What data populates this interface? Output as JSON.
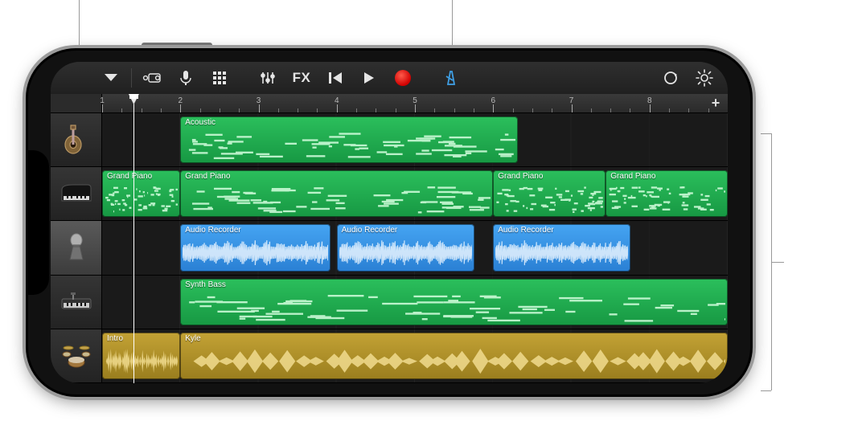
{
  "colors": {
    "accent_blue": "#3fa0e6",
    "record_red": "#d00000",
    "midi_green": "#2bbf5c",
    "audio_blue": "#45a4f2",
    "drum_yellow": "#c3a235"
  },
  "toolbar": {
    "view_menu": "▾",
    "instruments": "camera-icon",
    "microphone": "mic-icon",
    "grid": "grid-icon",
    "mixer": "sliders-icon",
    "fx_label": "FX",
    "rewind": "skip-back-icon",
    "play": "play-icon",
    "record": "record-icon",
    "metronome": "metronome-icon",
    "loop": "loop-icon",
    "settings": "gear-icon"
  },
  "ruler": {
    "bars": [
      1,
      2,
      3,
      4,
      5,
      6,
      7,
      8
    ],
    "beats_per_bar": 4,
    "add_section_label": "+"
  },
  "playhead": {
    "position_pct": 5.0
  },
  "tracks": [
    {
      "id": "acoustic",
      "icon": "guitar-icon",
      "selected": false,
      "regions": [
        {
          "label": "Acoustic",
          "type": "midi",
          "color": "green",
          "start_pct": 12.5,
          "width_pct": 54.0
        }
      ]
    },
    {
      "id": "grand-piano",
      "icon": "piano-icon",
      "selected": false,
      "regions": [
        {
          "label": "Grand Piano",
          "type": "midi",
          "color": "green",
          "start_pct": 0.0,
          "width_pct": 12.5
        },
        {
          "label": "Grand Piano",
          "type": "midi",
          "color": "green",
          "start_pct": 12.5,
          "width_pct": 50.0
        },
        {
          "label": "Grand Piano",
          "type": "midi",
          "color": "green",
          "start_pct": 62.5,
          "width_pct": 18.0
        },
        {
          "label": "Grand Piano",
          "type": "midi",
          "color": "green",
          "start_pct": 80.5,
          "width_pct": 19.5
        }
      ]
    },
    {
      "id": "audio-recorder",
      "icon": "mic-icon",
      "selected": true,
      "regions": [
        {
          "label": "Audio Recorder",
          "type": "audio",
          "color": "blue",
          "start_pct": 12.5,
          "width_pct": 24.0
        },
        {
          "label": "Audio Recorder",
          "type": "audio",
          "color": "blue",
          "start_pct": 37.5,
          "width_pct": 22.0
        },
        {
          "label": "Audio Recorder",
          "type": "audio",
          "color": "blue",
          "start_pct": 62.5,
          "width_pct": 22.0
        }
      ]
    },
    {
      "id": "synth-bass",
      "icon": "keyboard-icon",
      "selected": false,
      "regions": [
        {
          "label": "Synth Bass",
          "type": "midi",
          "color": "green",
          "start_pct": 12.5,
          "width_pct": 87.5
        }
      ]
    },
    {
      "id": "drums",
      "icon": "drums-icon",
      "selected": false,
      "regions": [
        {
          "label": "Intro",
          "type": "audio",
          "color": "yellow",
          "start_pct": 0.0,
          "width_pct": 12.5
        },
        {
          "label": "Kyle",
          "type": "audio",
          "color": "yellow",
          "start_pct": 12.5,
          "width_pct": 87.5
        }
      ]
    }
  ]
}
